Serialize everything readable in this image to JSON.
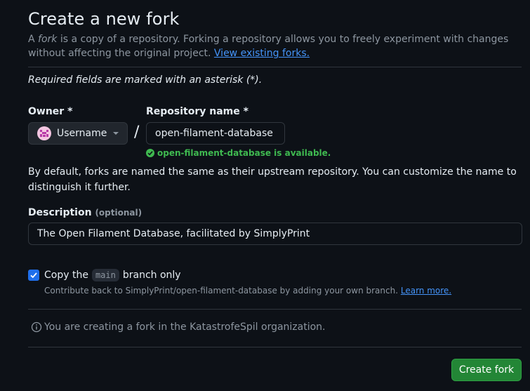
{
  "page": {
    "title": "Create a new fork",
    "intro_pre": "A ",
    "intro_em": "fork",
    "intro_post": " is a copy of a repository. Forking a repository allows you to freely experiment with changes without affecting the original project. ",
    "view_forks_link": "View existing forks.",
    "required_note": "Required fields are marked with an asterisk (*)."
  },
  "owner": {
    "label": "Owner *",
    "selected": "Username",
    "avatar_icon": "pink-identicon"
  },
  "separator": "/",
  "repo": {
    "label": "Repository name *",
    "value": "open-filament-database",
    "availability": "open-filament-database is available.",
    "availability_color": "#3fb950"
  },
  "naming_note": "By default, forks are named the same as their upstream repository. You can customize the name to distinguish it further.",
  "description": {
    "label": "Description",
    "optional_tag": "(optional)",
    "value": "The Open Filament Database, facilitated by SimplyPrint"
  },
  "copy_branch": {
    "checked": true,
    "label_pre": "Copy the",
    "branch": "main",
    "label_post": "branch only",
    "help_text": "Contribute back to SimplyPrint/open-filament-database by adding your own branch.",
    "learn_more": "Learn more."
  },
  "org_info": "You are creating a fork in the KatastrofeSpil organization.",
  "submit": {
    "label": "Create fork",
    "color": "#238636"
  }
}
